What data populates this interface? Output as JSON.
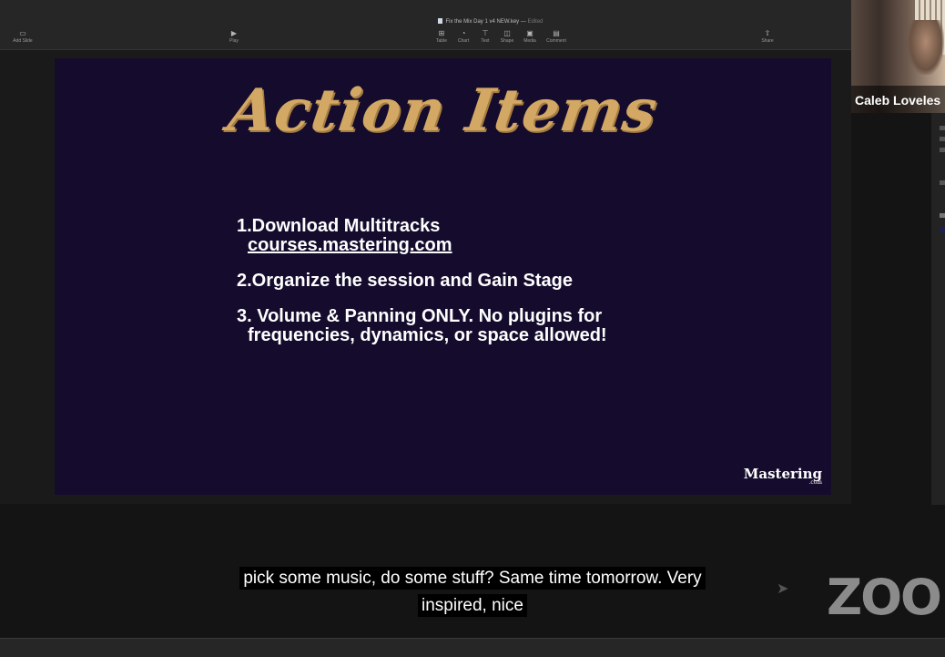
{
  "toolbar": {
    "document_title": "Fix the Mix Day 1 v4 NEW.key",
    "document_status": "Edited",
    "add_slide": "Add Slide",
    "play": "Play",
    "table": "Table",
    "chart": "Chart",
    "text": "Text",
    "shape": "Shape",
    "media": "Media",
    "comment": "Comment",
    "share": "Share"
  },
  "slide": {
    "title": "Action Items",
    "items": [
      {
        "line1": "1.Download Multitracks",
        "link": "courses.mastering.com"
      },
      {
        "line1": "2.Organize the session and Gain Stage"
      },
      {
        "line1": "3. Volume & Panning ONLY. No plugins for",
        "line2": "frequencies, dynamics, or space allowed!"
      }
    ],
    "logo": "Mastering",
    "logo_sub": ".com"
  },
  "participant": {
    "name": "Caleb Loveles"
  },
  "captions": {
    "line1": "pick some music, do some stuff? Same time tomorrow. Very",
    "line2": "inspired, nice"
  },
  "zoom": {
    "logo": "ZOO"
  },
  "colors": {
    "slide_bg": "#150c2d",
    "title_gold": "#d3a865"
  }
}
